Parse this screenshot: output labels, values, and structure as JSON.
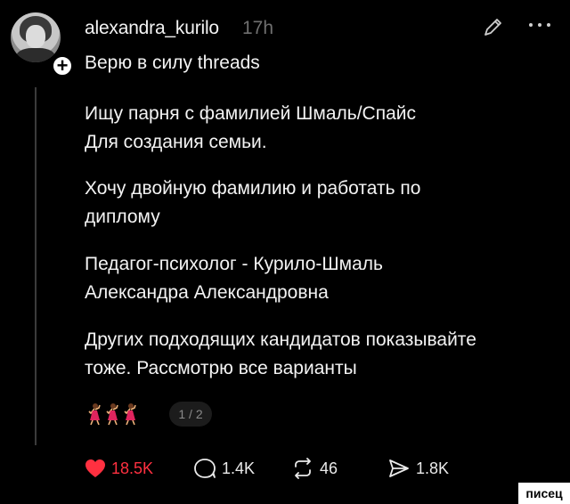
{
  "post": {
    "username": "alexandra_kurilo",
    "time": "17h",
    "topic": "Верю в силу threads",
    "paragraphs": [
      "Ищу парня с фамилией Шмаль/Спайс\nДля создания семьи.",
      "Хочу двойную фамилию и работать по\nдиплому",
      "Педагог-психолог - Курило-Шмаль\nАлександра Александровна",
      "Других подходящих кандидатов показывайте\nтоже. Рассмотрю все варианты"
    ],
    "emoji_icons": [
      "dancer-icon",
      "dancer-icon",
      "dancer-icon"
    ],
    "page_indicator": "1 / 2"
  },
  "actions": {
    "likes": "18.5K",
    "replies": "1.4K",
    "reposts": "46",
    "shares": "1.8K"
  },
  "watermark": "писец",
  "colors": {
    "background": "#000000",
    "text": "#f3f3f3",
    "muted": "#6f6f6f",
    "like": "#ff3040"
  }
}
